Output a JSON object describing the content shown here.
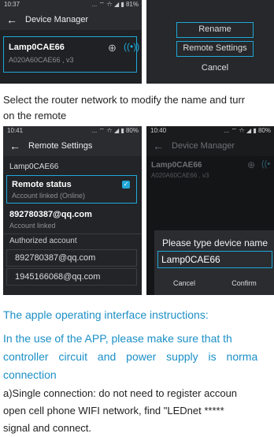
{
  "shot1": {
    "time": "10:37",
    "status_right": "... ⌔ ☆ ◢ ▮ 81%",
    "title": "Device Manager",
    "device_name": "Lamp0CAE66",
    "device_sub": "A020A60CAE66 , v3"
  },
  "shot2": {
    "rename": "Rename",
    "remote_settings": "Remote Settings",
    "cancel": "Cancel"
  },
  "caption1_line1": "Select the router network to modify the name and turr",
  "caption1_line2": "on the remote",
  "shot3": {
    "time": "10:41",
    "status_right": "... ⌔ ☆ ◢ ▮ 80%",
    "title": "Remote Settings",
    "device": "Lamp0CAE66",
    "remote_status": "Remote status",
    "remote_status_sub": "Account linked (Online)",
    "account": "892780387@qq.com",
    "account_sub": "Account linked",
    "authorized_label": "Authorized account",
    "authorized": [
      "892780387@qq.com",
      "1945166068@qq.com"
    ]
  },
  "shot4": {
    "time": "10:40",
    "status_right": "... ⌔ ☆ ◢ ▮ 80%",
    "title": "Device Manager",
    "device_name": "Lamp0CAE66",
    "device_sub": "A020A60CAE66 , v3",
    "dialog_title": "Please type device name",
    "input_value": "Lamp0CAE66",
    "cancel": "Cancel",
    "confirm": "Confirm"
  },
  "heading": "The apple operating interface instructions:",
  "para_blue_1": "In the use of the APP, please make sure that th",
  "para_blue_2": "controller circuit and power supply is norma",
  "para_blue_3": "connection",
  "para_a_1": "a)Single connection: do not need to register accoun",
  "para_a_2": "open cell phone WIFI network, find \"LEDnet *****",
  "para_a_3": "signal and connect."
}
